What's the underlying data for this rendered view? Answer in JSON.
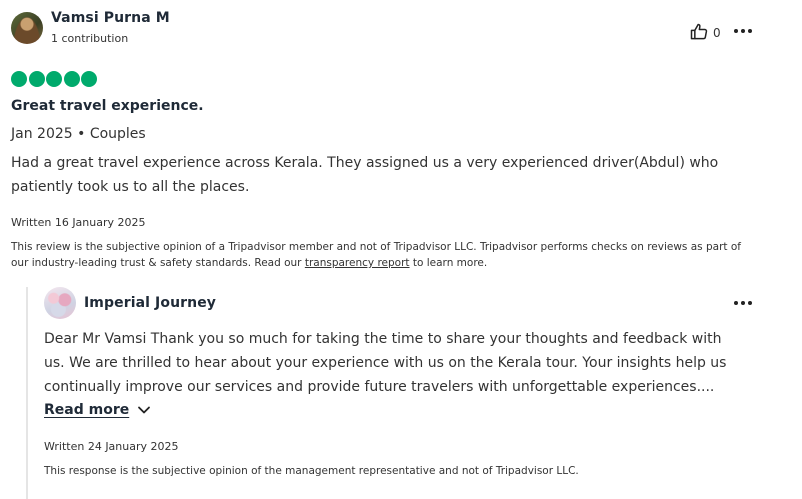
{
  "review": {
    "reviewer_name": "Vamsi Purna M",
    "contributions": "1 contribution",
    "helpful_count": "0",
    "rating": 5,
    "rating_color": "#00aa6c",
    "title": "Great travel experience.",
    "trip_info": "Jan 2025 • Couples",
    "body_line1": "Had a great travel experience across Kerala. They assigned us a very experienced driver(Abdul) who",
    "body_line2": "patiently took us to all the places.",
    "written_date": "Written 16 January 2025",
    "disclaimer_part1": "This review is the subjective opinion of a Tripadvisor member and not of Tripadvisor LLC. Tripadvisor performs checks on reviews as part of our industry-leading trust & safety standards. Read our ",
    "disclaimer_link": "transparency report",
    "disclaimer_part2": " to learn more.",
    "icons": {
      "thumbs_up": "thumbs-up-icon",
      "more": "more-options-icon"
    }
  },
  "response": {
    "owner_name": "Imperial Journey",
    "body_line1": "Dear Mr Vamsi Thank you so much for taking the time to share your thoughts and feedback with",
    "body_line2": "us. We are thrilled to hear about your experience with us on the Kerala tour. Your insights help us",
    "body_line3": "continually improve our services and provide future travelers with unforgettable experiences....",
    "read_more": "Read more",
    "written_date": "Written 24 January 2025",
    "disclaimer": "This response is the subjective opinion of the management representative and not of Tripadvisor LLC.",
    "icons": {
      "more": "more-options-icon",
      "expand": "chevron-down-icon"
    }
  }
}
